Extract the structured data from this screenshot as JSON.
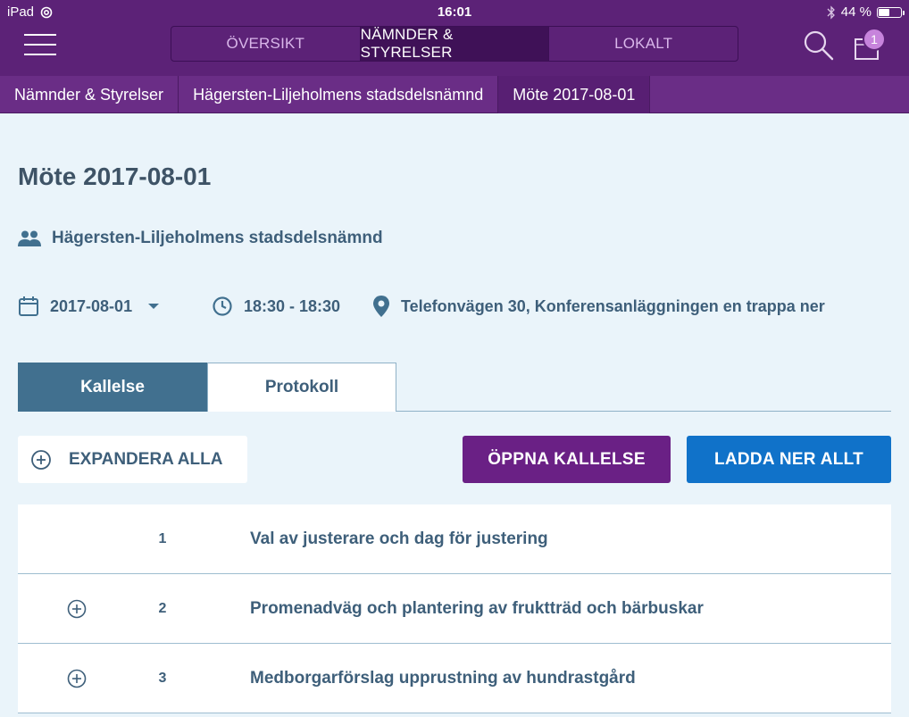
{
  "status_bar": {
    "device": "iPad",
    "time": "16:01",
    "battery": "44 %"
  },
  "nav": {
    "cart_count": "1",
    "segments": [
      {
        "label": "ÖVERSIKT"
      },
      {
        "label": "NÄMNDER & STYRELSER"
      },
      {
        "label": "LOKALT"
      }
    ],
    "active_segment": "NÄMNDER & STYRELSER"
  },
  "breadcrumb": [
    {
      "label": "Nämnder & Styrelser"
    },
    {
      "label": "Hägersten-Liljeholmens stadsdelsnämnd"
    },
    {
      "label": "Möte 2017-08-01"
    }
  ],
  "meeting": {
    "title": "Möte 2017-08-01",
    "organization": "Hägersten-Liljeholmens stadsdelsnämnd",
    "date": "2017-08-01",
    "time": "18:30 - 18:30",
    "location": "Telefonvägen 30, Konferensanläggningen en trappa ner"
  },
  "tabs": [
    {
      "label": "Kallelse",
      "active": true
    },
    {
      "label": "Protokoll",
      "active": false
    }
  ],
  "actions": {
    "expand_all": "EXPANDERA ALLA",
    "open_notice": "ÖPPNA KALLELSE",
    "download_all": "LADDA NER ALLT"
  },
  "agenda": [
    {
      "number": "1",
      "title": "Val av justerare och dag för justering",
      "expandable": false
    },
    {
      "number": "2",
      "title": "Promenadväg och plantering av fruktträd och bärbuskar",
      "expandable": true
    },
    {
      "number": "3",
      "title": "Medborgarförslag upprustning av hundrastgård",
      "expandable": true
    }
  ],
  "colors": {
    "header": "#5c2277",
    "primary_action": "#6a2085",
    "download_action": "#1072c9",
    "active_tab": "#41708f",
    "text": "#3e5f7a"
  }
}
